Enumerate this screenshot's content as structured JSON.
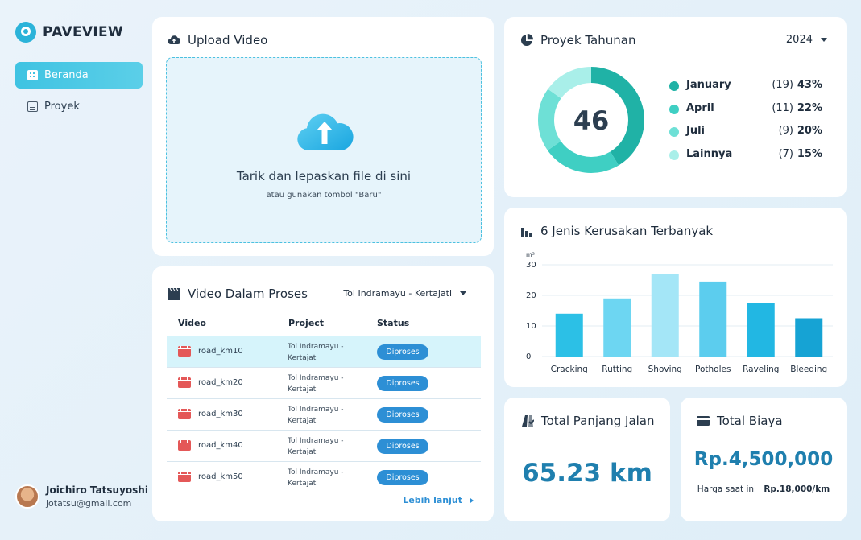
{
  "brand": {
    "name": "PAVEVIEW"
  },
  "sidebar": {
    "items": [
      {
        "label": "Beranda",
        "icon": "dashboard-icon",
        "active": true
      },
      {
        "label": "Proyek",
        "icon": "document-icon",
        "active": false
      }
    ],
    "user": {
      "name": "Joichiro Tatsuyoshi",
      "email": "jotatsu@gmail.com"
    }
  },
  "upload": {
    "title": "Upload Video",
    "drop_main": "Tarik dan lepaskan file di sini",
    "drop_sub": "atau gunakan tombol \"Baru\""
  },
  "videos": {
    "title": "Video Dalam Proses",
    "filter": "Tol Indramayu - Kertajati",
    "headers": [
      "Video",
      "Project",
      "Status"
    ],
    "rows": [
      {
        "video": "road_km10",
        "project": "Tol Indramayu - Kertajati",
        "status": "Diproses"
      },
      {
        "video": "road_km20",
        "project": "Tol Indramayu - Kertajati",
        "status": "Diproses"
      },
      {
        "video": "road_km30",
        "project": "Tol Indramayu - Kertajati",
        "status": "Diproses"
      },
      {
        "video": "road_km40",
        "project": "Tol Indramayu - Kertajati",
        "status": "Diproses"
      },
      {
        "video": "road_km50",
        "project": "Tol Indramayu - Kertajati",
        "status": "Diproses"
      }
    ],
    "more": "Lebih lanjut"
  },
  "annual": {
    "title": "Proyek Tahunan",
    "year": "2024",
    "total": "46",
    "legend": [
      {
        "label": "January",
        "count": "(19)",
        "pct": "43%",
        "color": "#20b2a6"
      },
      {
        "label": "April",
        "count": "(11)",
        "pct": "22%",
        "color": "#3fcfc3"
      },
      {
        "label": "Juli",
        "count": "(9)",
        "pct": "20%",
        "color": "#6ee0d6"
      },
      {
        "label": "Lainnya",
        "count": "(7)",
        "pct": "15%",
        "color": "#a9efe9"
      }
    ]
  },
  "damage": {
    "title": "6 Jenis Kerusakan Terbanyak",
    "unit": "m²"
  },
  "chart_data": {
    "type": "bar",
    "categories": [
      "Cracking",
      "Rutting",
      "Shoving",
      "Potholes",
      "Raveling",
      "Bleeding"
    ],
    "values": [
      14,
      19,
      27,
      24.5,
      17.5,
      12.5
    ],
    "colors": [
      "#2cc0e6",
      "#6dd6f2",
      "#a4e6f7",
      "#5ccdee",
      "#22b7e3",
      "#16a3d4"
    ],
    "yticks": [
      0,
      10,
      20,
      30
    ],
    "ylim": [
      0,
      30
    ],
    "ylabel": "m²"
  },
  "length": {
    "title": "Total Panjang Jalan",
    "value": "65.23 km"
  },
  "cost": {
    "title": "Total Biaya",
    "value": "Rp.4,500,000",
    "price_label": "Harga saat ini",
    "price_value": "Rp.18,000/km"
  }
}
